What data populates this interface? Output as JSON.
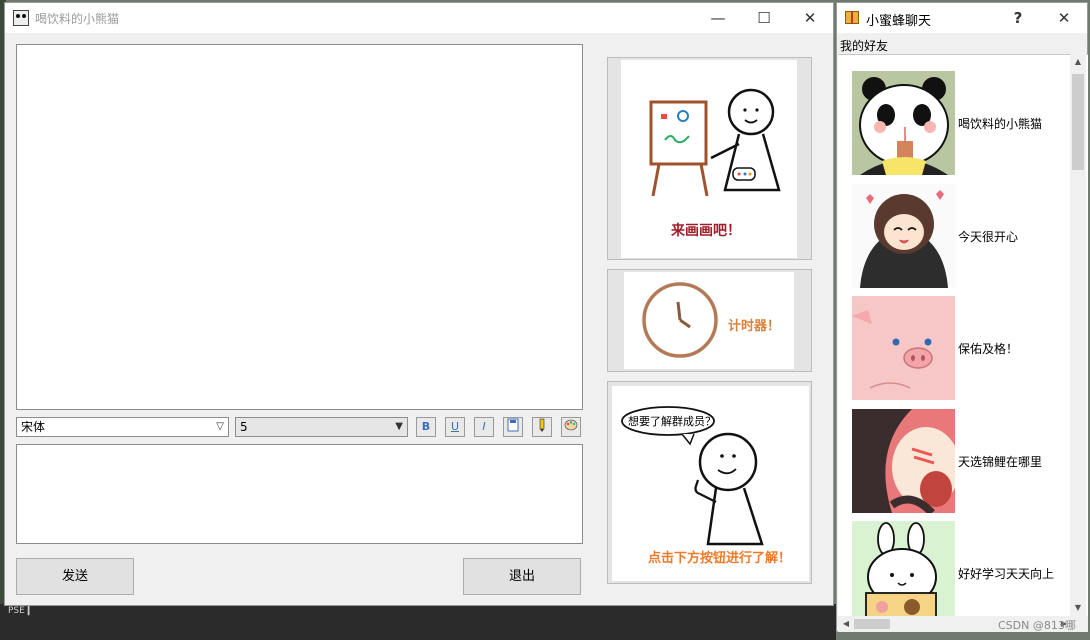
{
  "main_window": {
    "title": "喝饮料的小熊猫",
    "minimize": "—",
    "maximize": "☐",
    "close": "✕",
    "font_combo": "宋体",
    "size_combo": "5",
    "format_buttons": {
      "bold": "B",
      "underline": "U",
      "italic": "I"
    },
    "send_label": "发送",
    "exit_label": "退出"
  },
  "cards": {
    "draw_text": "来画画吧！",
    "timer_text": "计时器！",
    "members_bubble": "想要了解群成员？",
    "members_text": "点击下方按钮进行了解！"
  },
  "friends_window": {
    "title": "小蜜蜂聊天",
    "help": "?",
    "close": "✕",
    "section_label": "我的好友",
    "friends": [
      {
        "name": "喝饮料的小熊猫",
        "avatar": "panda-avatar"
      },
      {
        "name": "今天很开心",
        "avatar": "girl-avatar"
      },
      {
        "name": "保佑及格！",
        "avatar": "pig-avatar"
      },
      {
        "name": "天选锦鲤在哪里",
        "avatar": "cartoon-avatar"
      },
      {
        "name": "好好学习天天向上",
        "avatar": "bunny-avatar"
      }
    ]
  },
  "watermark": "CSDN @813哪"
}
